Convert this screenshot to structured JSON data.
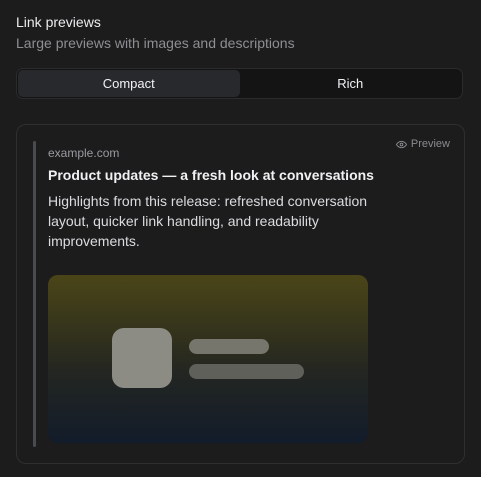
{
  "section": {
    "title": "Link previews",
    "subtitle": "Large previews with images and descriptions"
  },
  "toggle": {
    "options": [
      {
        "label": "Compact",
        "selected": true
      },
      {
        "label": "Rich",
        "selected": false
      }
    ]
  },
  "preview": {
    "tag_label": "Preview",
    "tag_icon": "eye-icon",
    "domain": "example.com",
    "headline": "Product updates — a fresh look at conversations",
    "description": "Highlights from this release: refreshed conversation layout, quicker link handling, and readability improvements."
  },
  "colors": {
    "background": "#1c1c1d",
    "accent_bar": "#4a4b50",
    "thumbnail_top": "#4a4518",
    "thumbnail_bottom": "#121c2a"
  }
}
